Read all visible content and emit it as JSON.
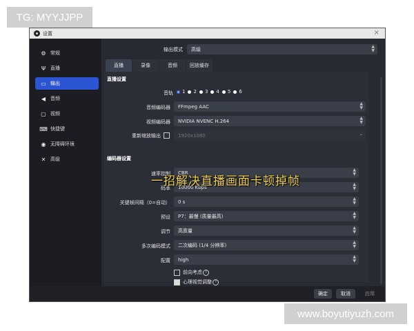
{
  "watermark": {
    "top_left": "TG: MYYJJPP",
    "bottom_right": "www.boyutiyuzh.com"
  },
  "window": {
    "title": "设置",
    "close_glyph": "×"
  },
  "sidebar": {
    "items": [
      {
        "label": "常规",
        "icon": "gear-icon",
        "glyph": "⚙"
      },
      {
        "label": "直播",
        "icon": "antenna-icon",
        "glyph": "Ψ"
      },
      {
        "label": "输出",
        "icon": "output-icon",
        "glyph": "▭"
      },
      {
        "label": "音频",
        "icon": "speaker-icon",
        "glyph": "◀"
      },
      {
        "label": "视频",
        "icon": "monitor-icon",
        "glyph": "▢"
      },
      {
        "label": "快捷键",
        "icon": "keyboard-icon",
        "glyph": "⌨"
      },
      {
        "label": "无障碍环境",
        "icon": "accessibility-icon",
        "glyph": "◉"
      },
      {
        "label": "高级",
        "icon": "wrench-icon",
        "glyph": "✕"
      }
    ],
    "active_index": 2
  },
  "output_mode": {
    "label": "输出模式",
    "value": "高级"
  },
  "tabs": [
    {
      "label": "直播"
    },
    {
      "label": "录像"
    },
    {
      "label": "音频"
    },
    {
      "label": "回放缓存"
    }
  ],
  "streaming": {
    "section_title": "直播设置",
    "track_label": "音轨",
    "tracks": [
      "1",
      "2",
      "3",
      "4",
      "5",
      "6"
    ],
    "selected_track": "1",
    "audio_encoder_label": "音频编码器",
    "audio_encoder": "FFmpeg AAC",
    "video_encoder_label": "视频编码器",
    "video_encoder": "NVIDIA NVENC H.264",
    "rescale_label": "重新缩放输出",
    "rescale_value": "1920x1080"
  },
  "overlay_caption": "一招解决直播画面卡顿掉帧",
  "encoder": {
    "section_title": "编码器设置",
    "fields": [
      {
        "label": "速率控制",
        "value": "CBR",
        "arrow": "chevron"
      },
      {
        "label": "码率",
        "value": "10000 Kbps",
        "arrow": "stepper"
      },
      {
        "label": "关键帧间隔（0=自动）",
        "value": "0 s",
        "arrow": "stepper"
      },
      {
        "label": "预设",
        "value": "P7：最慢 (质量最高)",
        "arrow": "chevron"
      },
      {
        "label": "调节",
        "value": "高质量",
        "arrow": "chevron"
      },
      {
        "label": "多次编码模式",
        "value": "二次编码 (1/4 分辨率)",
        "arrow": "chevron"
      },
      {
        "label": "配置",
        "value": "high",
        "arrow": "chevron"
      }
    ],
    "lookahead_label": "前向考虑",
    "psycho_label": "心理视觉调整"
  },
  "footer": {
    "ok": "确定",
    "cancel": "取消",
    "apply": "应用"
  },
  "colors": {
    "accent": "#2c55d6",
    "caption": "#f2d24a"
  }
}
